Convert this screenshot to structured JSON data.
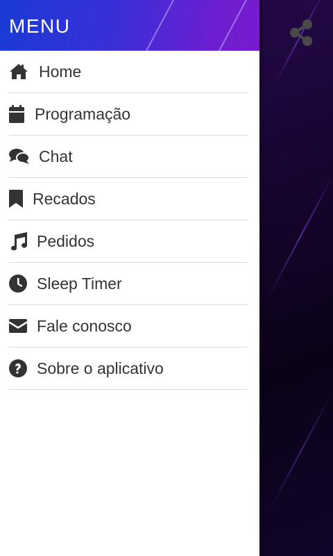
{
  "drawer": {
    "title": "MENU",
    "items": [
      {
        "label": "Home",
        "icon": "home-icon"
      },
      {
        "label": "Programação",
        "icon": "calendar-icon"
      },
      {
        "label": "Chat",
        "icon": "chat-icon"
      },
      {
        "label": "Recados",
        "icon": "bookmark-icon"
      },
      {
        "label": "Pedidos",
        "icon": "music-icon"
      },
      {
        "label": "Sleep Timer",
        "icon": "clock-icon"
      },
      {
        "label": "Fale conosco",
        "icon": "envelope-icon"
      },
      {
        "label": "Sobre o aplicativo",
        "icon": "question-circle-icon"
      }
    ]
  },
  "toolbar": {
    "share_icon": "share-icon"
  },
  "colors": {
    "header_gradient_start": "#1a3bd6",
    "header_gradient_end": "#7a1ad0",
    "menu_text": "#333333",
    "divider": "#d9d9d9",
    "background_dark": "#12052a"
  }
}
